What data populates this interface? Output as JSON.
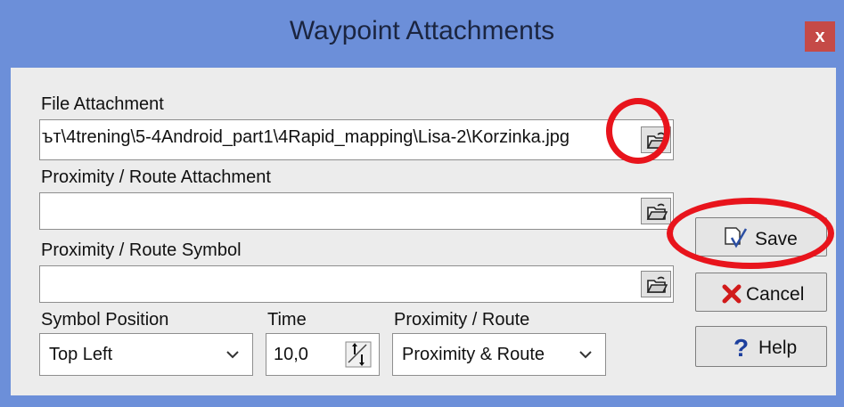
{
  "window": {
    "title": "Waypoint Attachments",
    "close_glyph": "x"
  },
  "file_attachment": {
    "label": "File Attachment",
    "value": "ът\\4trening\\5-4Android_part1\\4Rapid_mapping\\Lisa-2\\Korzinka.jpg",
    "browse_icon": "folder-open-icon"
  },
  "proximity_attachment": {
    "label": "Proximity / Route Attachment",
    "value": "",
    "browse_icon": "folder-open-icon"
  },
  "proximity_symbol": {
    "label": "Proximity / Route Symbol",
    "value": "",
    "browse_icon": "folder-open-icon"
  },
  "symbol_position": {
    "label": "Symbol Position",
    "value": "Top Left"
  },
  "time": {
    "label": "Time",
    "value": "10,0"
  },
  "proximity_route": {
    "label": "Proximity / Route",
    "value": "Proximity & Route"
  },
  "buttons": {
    "save": "Save",
    "cancel": "Cancel",
    "help": "Help"
  },
  "colors": {
    "titlebar": "#6c8fd9",
    "close": "#c54a47",
    "annotation": "#e8141c"
  }
}
